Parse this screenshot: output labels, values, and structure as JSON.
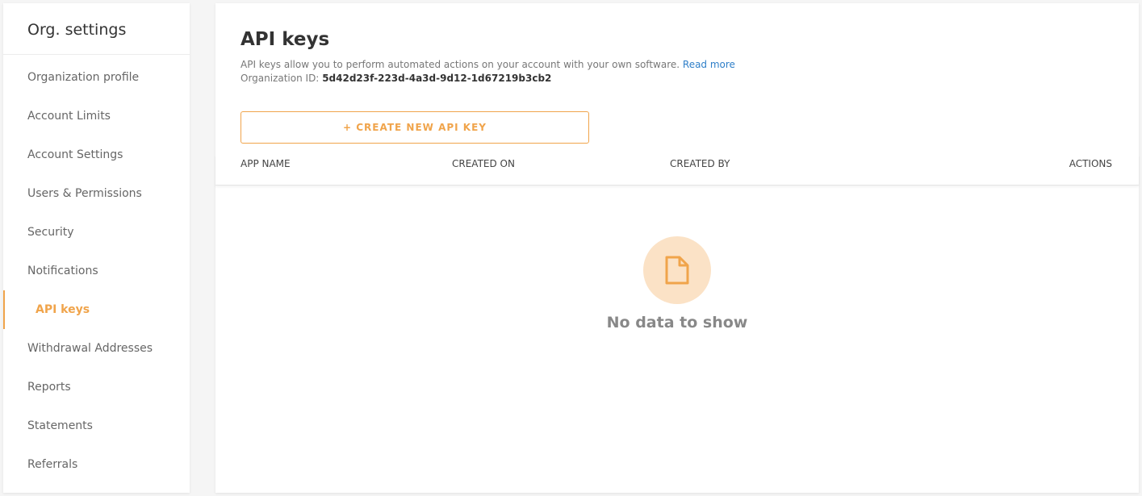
{
  "sidebar": {
    "title": "Org. settings",
    "items": [
      {
        "label": "Organization profile"
      },
      {
        "label": "Account Limits"
      },
      {
        "label": "Account Settings"
      },
      {
        "label": "Users & Permissions"
      },
      {
        "label": "Security"
      },
      {
        "label": "Notifications"
      },
      {
        "label": "API keys"
      },
      {
        "label": "Withdrawal Addresses"
      },
      {
        "label": "Reports"
      },
      {
        "label": "Statements"
      },
      {
        "label": "Referrals"
      }
    ],
    "active_index": 6
  },
  "main": {
    "title": "API keys",
    "description": "API keys allow you to perform automated actions on your account with your own software.",
    "read_more": "Read more",
    "org_id_label": "Organization ID:",
    "org_id_value": "5d42d23f-223d-4a3d-9d12-1d67219b3cb2",
    "create_button": "+ CREATE NEW API KEY",
    "table": {
      "columns": [
        "APP NAME",
        "CREATED ON",
        "CREATED BY",
        "ACTIONS"
      ]
    },
    "empty_state": {
      "icon": "document-icon",
      "text": "No data to show"
    }
  },
  "colors": {
    "accent": "#f0a44b",
    "link": "#2f7fc8",
    "empty_icon_bg": "#fbe2c6"
  }
}
